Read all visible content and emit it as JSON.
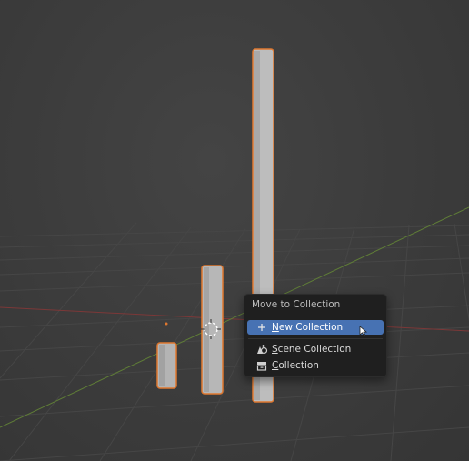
{
  "viewport": {
    "background": "#3d3d3d",
    "grid_color": "#484848",
    "x_axis_color": "#8a3a3a",
    "y_axis_color": "#6a8a3a",
    "object_color": "#b9b9b9",
    "selection_outline": "#e0782f"
  },
  "context_menu": {
    "title": "Move to Collection",
    "items": [
      {
        "icon": "plus-icon",
        "label_first": "N",
        "label_rest": "ew Collection",
        "active": true
      },
      {
        "icon": "scene-collection-icon",
        "label_first": "S",
        "label_rest": "cene Collection",
        "active": false
      },
      {
        "icon": "collection-icon",
        "label_first": "C",
        "label_rest": "ollection",
        "active": false
      }
    ],
    "active_color": "#4772b3"
  }
}
